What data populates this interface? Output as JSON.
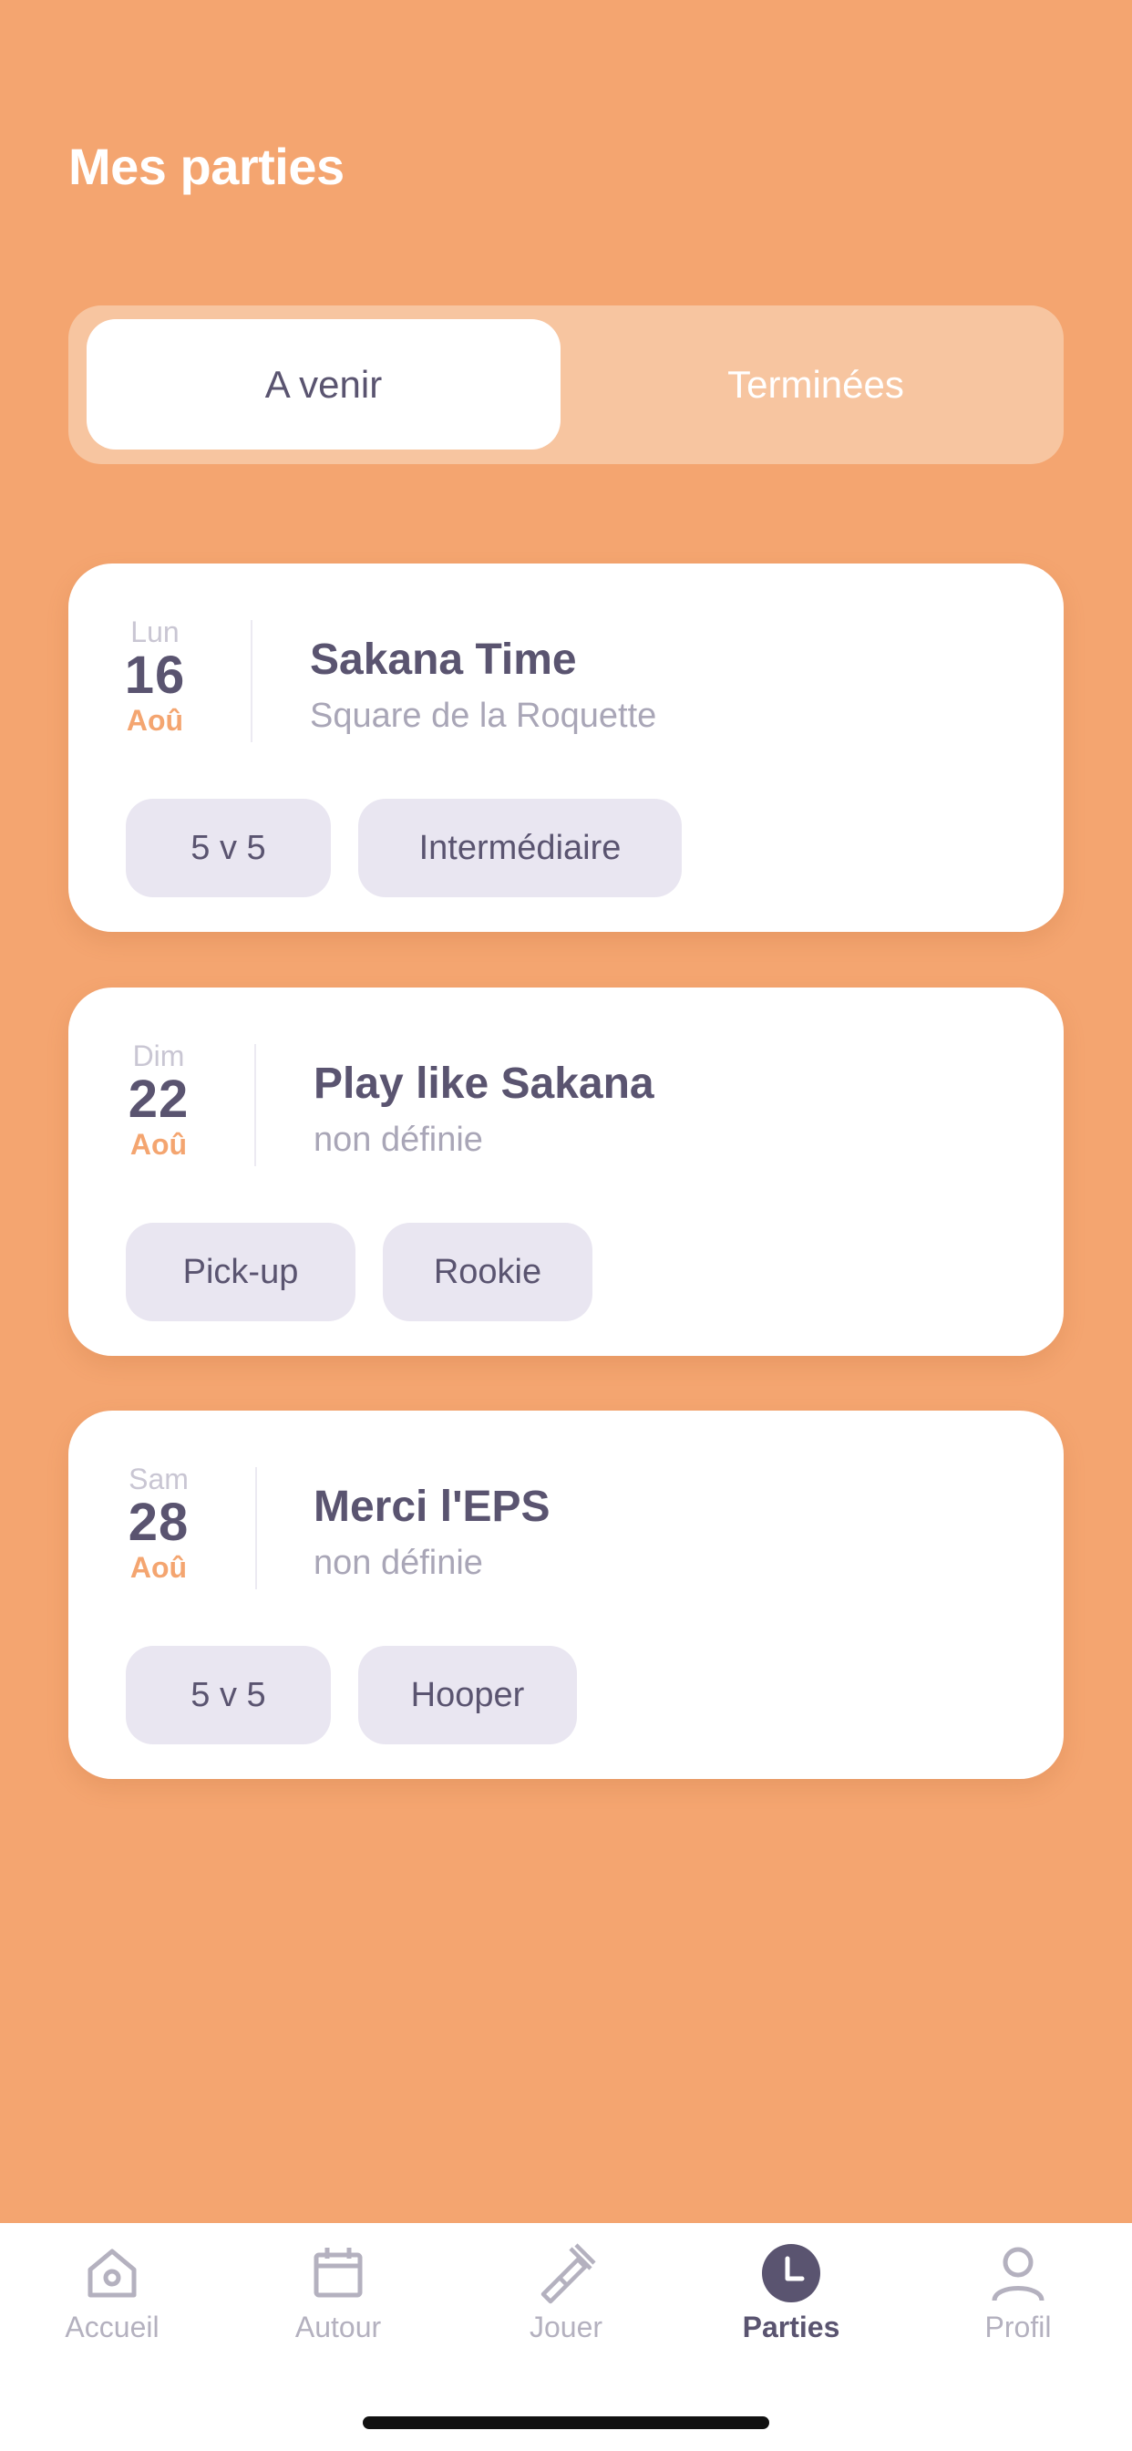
{
  "header": {
    "title": "Mes parties"
  },
  "segments": {
    "upcoming": "A venir",
    "finished": "Terminées"
  },
  "games": [
    {
      "day": "Lun",
      "date": "16",
      "month": "Aoû",
      "title": "Sakana Time",
      "location": "Square de la Roquette",
      "tags": [
        "5 v 5",
        "Intermédiaire"
      ]
    },
    {
      "day": "Dim",
      "date": "22",
      "month": "Aoû",
      "title": "Play like Sakana",
      "location": "non définie",
      "tags": [
        "Pick-up",
        "Rookie"
      ]
    },
    {
      "day": "Sam",
      "date": "28",
      "month": "Aoû",
      "title": "Merci l'EPS",
      "location": "non définie",
      "tags": [
        "5 v 5",
        "Hooper"
      ]
    }
  ],
  "tabbar": {
    "items": [
      {
        "label": "Accueil",
        "icon": "home-icon"
      },
      {
        "label": "Autour",
        "icon": "calendar-icon"
      },
      {
        "label": "Jouer",
        "icon": "play-icon"
      },
      {
        "label": "Parties",
        "icon": "clock-icon",
        "active": true
      },
      {
        "label": "Profil",
        "icon": "profile-icon"
      }
    ]
  },
  "colors": {
    "background": "#F4A570",
    "accent": "#F4A570",
    "text": "#5A5470",
    "tag": "#E9E6F1"
  }
}
